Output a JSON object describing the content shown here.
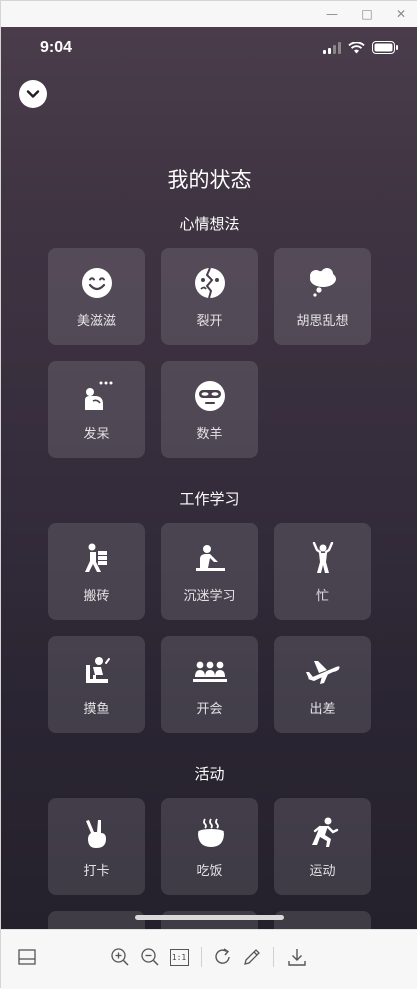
{
  "window": {
    "minimize_glyph": "—",
    "maximize_glyph": "□",
    "close_glyph": "✕"
  },
  "status_bar": {
    "time": "9:04",
    "icons": [
      "signal-icon",
      "wifi-icon",
      "battery-icon"
    ]
  },
  "header": {
    "title": "我的状态",
    "collapse_icon": "chevron-down-icon"
  },
  "sections": [
    {
      "title": "心情想法",
      "items": [
        {
          "label": "美滋滋",
          "icon": "smile-icon"
        },
        {
          "label": "裂开",
          "icon": "cracked-face-icon"
        },
        {
          "label": "胡思乱想",
          "icon": "thought-cloud-icon"
        },
        {
          "label": "发呆",
          "icon": "daze-person-icon"
        },
        {
          "label": "数羊",
          "icon": "sleep-mask-icon"
        }
      ]
    },
    {
      "title": "工作学习",
      "items": [
        {
          "label": "搬砖",
          "icon": "carry-bricks-icon"
        },
        {
          "label": "沉迷学习",
          "icon": "study-desk-icon"
        },
        {
          "label": "忙",
          "icon": "busy-person-icon"
        },
        {
          "label": "摸鱼",
          "icon": "slacking-chair-icon"
        },
        {
          "label": "开会",
          "icon": "meeting-icon"
        },
        {
          "label": "出差",
          "icon": "airplane-icon"
        }
      ]
    },
    {
      "title": "活动",
      "items": [
        {
          "label": "打卡",
          "icon": "peace-hand-icon"
        },
        {
          "label": "吃饭",
          "icon": "rice-bowl-icon"
        },
        {
          "label": "运动",
          "icon": "running-icon"
        }
      ]
    }
  ],
  "viewer_toolbar": {
    "actual_size_label": "1:1",
    "buttons": [
      "panel-toggle-icon",
      "zoom-in-icon",
      "zoom-out-icon",
      "actual-size-icon",
      "rotate-icon",
      "edit-pen-icon",
      "download-icon"
    ]
  }
}
